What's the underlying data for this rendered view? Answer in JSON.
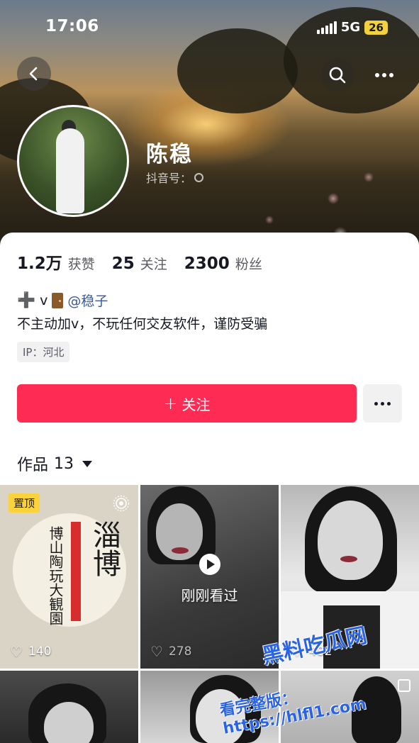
{
  "status_bar": {
    "time": "17:06",
    "network": "5G",
    "battery": "26"
  },
  "profile": {
    "name": "陈稳",
    "douyin_id_label": "抖音号：",
    "stats": [
      {
        "num": "1.2万",
        "label": "获赞"
      },
      {
        "num": "25",
        "label": "关注"
      },
      {
        "num": "2300",
        "label": "粉丝"
      }
    ],
    "bio_line1_v": "v",
    "bio_mention": "@稳子",
    "bio_line2": "不主动加v，不玩任何交友软件，谨防受骗",
    "ip": "IP：河北",
    "follow_label": "关注",
    "follow_plus": "+"
  },
  "works": {
    "label": "作品",
    "count": "13"
  },
  "tiles": [
    {
      "likes": "140",
      "pinned_label": "置顶",
      "calli_big": "淄博",
      "calli_small": "博山陶玩大観園"
    },
    {
      "likes": "278",
      "viewed_label": "刚刚看过"
    },
    {
      "likes": "482"
    }
  ],
  "watermark": {
    "line1": "黑料吃瓜网",
    "line2": "看完整版：https://hlfl1.com"
  },
  "colors": {
    "accent": "#fe2c55",
    "pin_badge": "#f9d23c",
    "mention": "#3b5998"
  },
  "icons": [
    "back-arrow-icon",
    "search-icon",
    "more-icon",
    "plus-icon",
    "door-icon",
    "heart-icon",
    "play-icon",
    "multi-image-icon"
  ]
}
